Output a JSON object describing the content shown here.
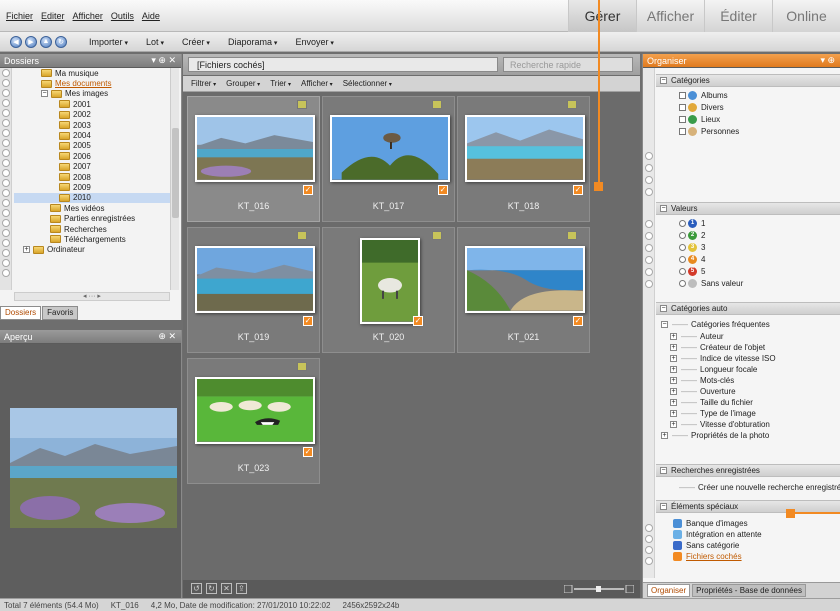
{
  "menubar": {
    "menus": [
      "Fichier",
      "Editer",
      "Afficher",
      "Outils",
      "Aide"
    ],
    "tabs": [
      "Gérer",
      "Afficher",
      "Éditer",
      "Online"
    ]
  },
  "toolbar": {
    "buttons": [
      "Importer",
      "Lot",
      "Créer",
      "Diaporama",
      "Envoyer"
    ]
  },
  "folders": {
    "title": "Dossiers",
    "tree": [
      {
        "label": "Ma musique",
        "indent": 3
      },
      {
        "label": "Mes documents",
        "indent": 3,
        "link": true
      },
      {
        "label": "Mes images",
        "indent": 3
      },
      {
        "label": "2001",
        "indent": 5
      },
      {
        "label": "2002",
        "indent": 5
      },
      {
        "label": "2003",
        "indent": 5
      },
      {
        "label": "2004",
        "indent": 5
      },
      {
        "label": "2005",
        "indent": 5
      },
      {
        "label": "2006",
        "indent": 5
      },
      {
        "label": "2007",
        "indent": 5
      },
      {
        "label": "2008",
        "indent": 5
      },
      {
        "label": "2009",
        "indent": 5
      },
      {
        "label": "2010",
        "indent": 5,
        "selected": true
      },
      {
        "label": "Mes vidéos",
        "indent": 4
      },
      {
        "label": "Parties enregistrées",
        "indent": 4
      },
      {
        "label": "Recherches",
        "indent": 4
      },
      {
        "label": "Téléchargements",
        "indent": 4
      },
      {
        "label": "Ordinateur",
        "indent": 1
      }
    ],
    "tabs": [
      "Dossiers",
      "Favoris"
    ]
  },
  "apercu": {
    "title": "Aperçu"
  },
  "center": {
    "path": "[Fichiers cochés]",
    "search_placeholder": "Recherche rapide",
    "filters": [
      "Filtrer",
      "Grouper",
      "Trier",
      "Afficher",
      "Sélectionner"
    ],
    "thumbnails": [
      {
        "name": "KT_016",
        "scene": "lake"
      },
      {
        "name": "KT_017",
        "scene": "bird"
      },
      {
        "name": "KT_018",
        "scene": "lake2"
      },
      {
        "name": "KT_019",
        "scene": "lake3"
      },
      {
        "name": "KT_020",
        "scene": "sheep1"
      },
      {
        "name": "KT_021",
        "scene": "coast"
      },
      {
        "name": "KT_023",
        "scene": "sheep"
      }
    ]
  },
  "organiser": {
    "title": "Organiser",
    "sections": {
      "categories": "Catégories",
      "valeurs": "Valeurs",
      "auto": "Catégories auto",
      "recherches": "Recherches enregistrées",
      "speciaux": "Éléments spéciaux"
    },
    "categories": [
      "Albums",
      "Divers",
      "Lieux",
      "Personnes"
    ],
    "valeurs": [
      "1",
      "2",
      "3",
      "4",
      "5",
      "Sans valeur"
    ],
    "auto_parent": "Catégories fréquentes",
    "auto_items": [
      "Auteur",
      "Créateur de l'objet",
      "Indice de vitesse ISO",
      "Longueur focale",
      "Mots-clés",
      "Ouverture",
      "Taille du fichier",
      "Type de l'image",
      "Vitesse d'obturation"
    ],
    "auto_extra": "Propriétés de la photo",
    "new_search": "Créer une nouvelle recherche enregistrée",
    "speciaux": [
      "Banque d'images",
      "Intégration en attente",
      "Sans catégorie",
      "Fichiers cochés"
    ],
    "tabs": [
      "Organiser",
      "Propriétés - Base de données"
    ]
  },
  "status": {
    "total": "Total 7 éléments (54.4 Mo)",
    "file": "KT_016",
    "info": "4,2 Mo, Date de modification: 27/01/2010 10:22:02",
    "dims": "2456x2592x24b"
  },
  "colors": {
    "accent": "#f28a22",
    "link": "#c05a00"
  }
}
